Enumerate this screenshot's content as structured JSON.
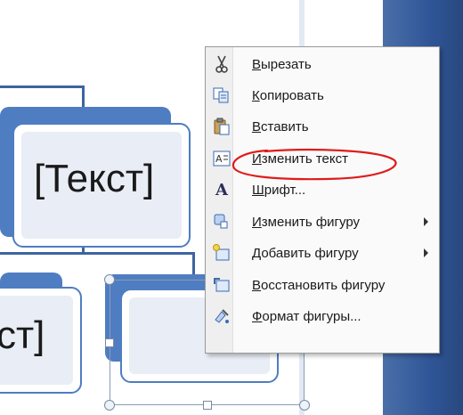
{
  "canvas": {
    "top_shape_text": "[Текст]",
    "bottom_shape_text": "ст]"
  },
  "context_menu": {
    "items": [
      {
        "icon": "scissors-icon",
        "label": "Вырезать",
        "has_submenu": false
      },
      {
        "icon": "copy-icon",
        "label": "Копировать",
        "has_submenu": false
      },
      {
        "icon": "paste-icon",
        "label": "Вставить",
        "has_submenu": false
      },
      {
        "icon": "edit-text-icon",
        "label": "Изменить текст",
        "has_submenu": false
      },
      {
        "icon": "font-icon",
        "label": "Шрифт...",
        "has_submenu": false
      },
      {
        "icon": "change-shape-icon",
        "label": "Изменить фигуру",
        "has_submenu": true
      },
      {
        "icon": "add-shape-icon",
        "label": "Добавить фигуру",
        "has_submenu": true
      },
      {
        "icon": "reset-shape-icon",
        "label": "Восстановить фигуру",
        "has_submenu": false
      },
      {
        "icon": "format-shape-icon",
        "label": "Формат фигуры...",
        "has_submenu": false
      }
    ]
  },
  "colors": {
    "smartart_blue": "#4f7dc1",
    "connector_blue": "#3d64a0",
    "annotation_red": "#e01b1b"
  }
}
